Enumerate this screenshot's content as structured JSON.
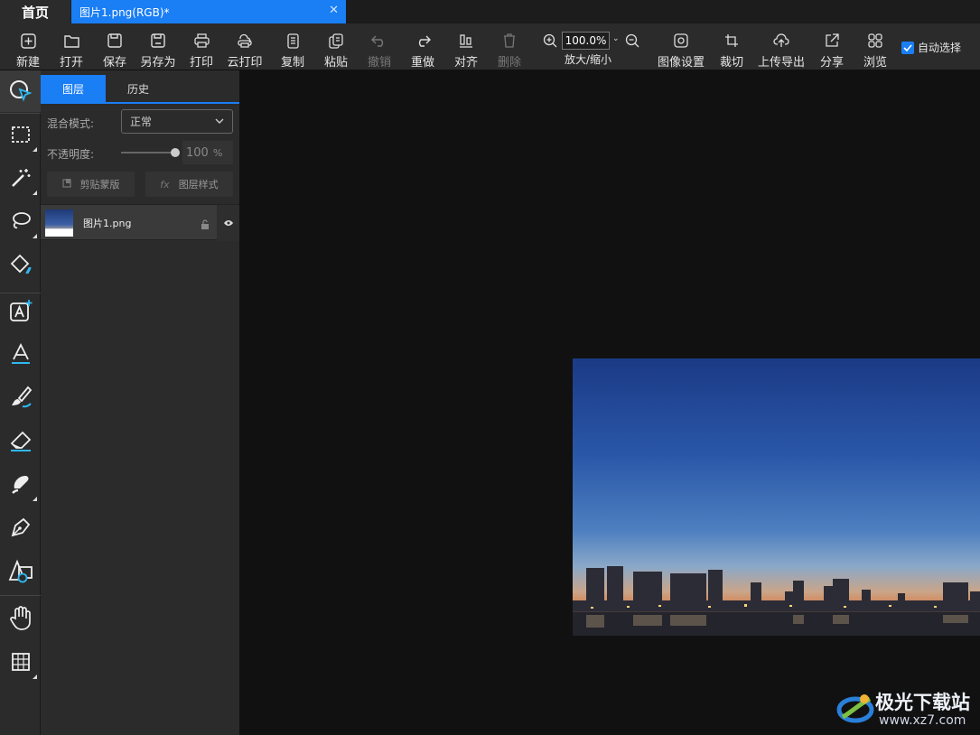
{
  "tabs": {
    "home": "首页",
    "document": "图片1.png(RGB)*"
  },
  "toolbar": {
    "new": "新建",
    "open": "打开",
    "save": "保存",
    "save_as": "另存为",
    "print": "打印",
    "cloud_print": "云打印",
    "copy": "复制",
    "paste": "粘贴",
    "undo": "撤销",
    "redo": "重做",
    "align": "对齐",
    "delete": "删除",
    "zoom_value": "100.0%",
    "zoom_label": "放大/缩小",
    "image_settings": "图像设置",
    "crop": "裁切",
    "upload_export": "上传导出",
    "share": "分享",
    "browse": "浏览",
    "auto_select": "自动选择"
  },
  "panel": {
    "tab_layers": "图层",
    "tab_history": "历史",
    "blend_mode_label": "混合模式:",
    "blend_mode_value": "正常",
    "opacity_label": "不透明度:",
    "opacity_value": "100",
    "opacity_unit": "%",
    "clip_mask": "剪贴蒙版",
    "layer_style": "图层样式",
    "fx": "fx",
    "layer_name": "图片1.png"
  },
  "opacity_level": 1.0,
  "watermark": {
    "name": "极光下载站",
    "url": "www.xz7.com"
  },
  "colors": {
    "accent": "#1a7ef5",
    "toolbar": "#2b2b2b",
    "canvas": "#111111"
  }
}
